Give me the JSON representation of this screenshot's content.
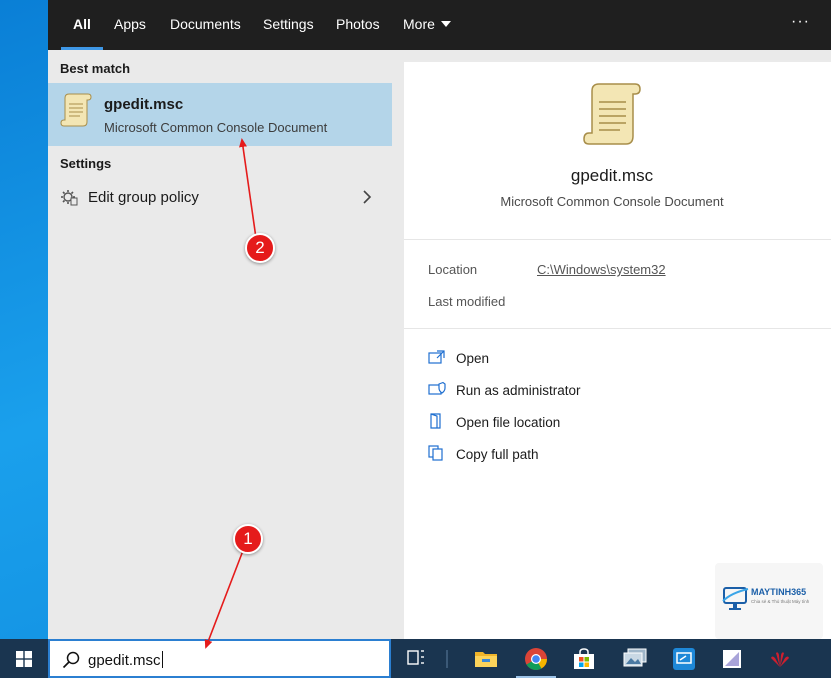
{
  "tabs": [
    {
      "label": "All",
      "active": true
    },
    {
      "label": "Apps"
    },
    {
      "label": "Documents"
    },
    {
      "label": "Settings"
    },
    {
      "label": "Photos"
    },
    {
      "label": "More"
    }
  ],
  "more_options_label": "···",
  "results": {
    "best_match_heading": "Best match",
    "best_match": {
      "title": "gpedit.msc",
      "subtitle": "Microsoft Common Console Document"
    },
    "settings_heading": "Settings",
    "settings_items": [
      {
        "label": "Edit group policy"
      }
    ]
  },
  "details": {
    "title": "gpedit.msc",
    "subtitle": "Microsoft Common Console Document",
    "location_label": "Location",
    "location_value": "C:\\Windows\\system32",
    "last_modified_label": "Last modified",
    "actions": [
      {
        "label": "Open",
        "icon": "open-icon"
      },
      {
        "label": "Run as administrator",
        "icon": "shield-icon"
      },
      {
        "label": "Open file location",
        "icon": "folder-location-icon"
      },
      {
        "label": "Copy full path",
        "icon": "copy-icon"
      }
    ]
  },
  "taskbar": {
    "search_value": "gpedit.msc",
    "apps": [
      "task-view-icon",
      "file-explorer-icon",
      "chrome-icon",
      "store-icon",
      "photos-icon",
      "remote-desktop-icon"
    ]
  },
  "annotations": [
    {
      "label": "1"
    },
    {
      "label": "2"
    }
  ],
  "watermark": {
    "brand": "MAYTINH365",
    "tagline": "Chia sẻ & Thủ thuật Máy tính"
  },
  "colors": {
    "accent": "#3e97e6",
    "selection": "#b4d5e9",
    "taskbar": "#1a3550",
    "annotation": "#e51b1b"
  }
}
